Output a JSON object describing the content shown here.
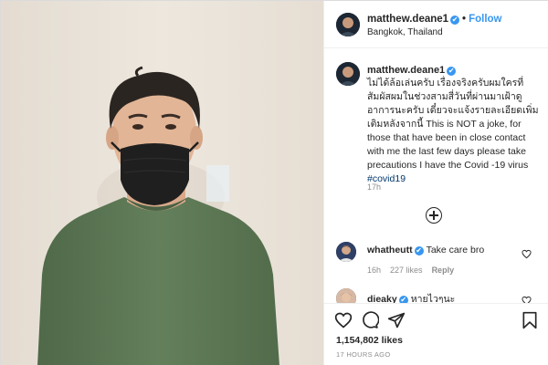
{
  "post": {
    "username": "matthew.deane1",
    "verified_mark": "✔",
    "separator": "•",
    "follow_label": "Follow",
    "location": "Bangkok, Thailand",
    "photo_alt": "photo of a man wearing a black face mask and olive green t-shirt",
    "avatar_icon": "profile-avatar"
  },
  "caption": {
    "username": "matthew.deane1",
    "text": "ไม่ได้ล้อเล่นครับ เรื่องจริงครับผมใครที่สัมผัสผมในช่วงสามสี่วันที่ผ่านมาเฝ้าดูอาการนะครับ เดี๋ยวจะแจ้งรายละเอียดเพิ่มเติมหลังจากนี้ This is NOT a joke, for those that have been in close contact with me the last few days please take precautions I have the Covid -19 virus ",
    "hashtag": "#covid19",
    "time": "17h"
  },
  "load_more_icon": "plus-circle-icon",
  "comments": [
    {
      "username": "whatheutt",
      "text": "Take care bro",
      "time": "16h",
      "likes": "227 likes",
      "reply_label": "Reply"
    },
    {
      "username": "dieaky",
      "text": "หายไวๆนะ"
    }
  ],
  "actions": {
    "icons": [
      "heart-icon",
      "comment-icon",
      "share-icon",
      "bookmark-icon"
    ],
    "likes": "1,154,802 likes",
    "posted_ago": "17 HOURS AGO"
  },
  "colors": {
    "accent": "#3897f0",
    "text": "#262626",
    "muted": "#8e8e8e",
    "border": "#dbdbdb",
    "photo_wall": "#e9e2d8",
    "shirt": "#5e7a56",
    "mask": "#1f1f1f"
  }
}
